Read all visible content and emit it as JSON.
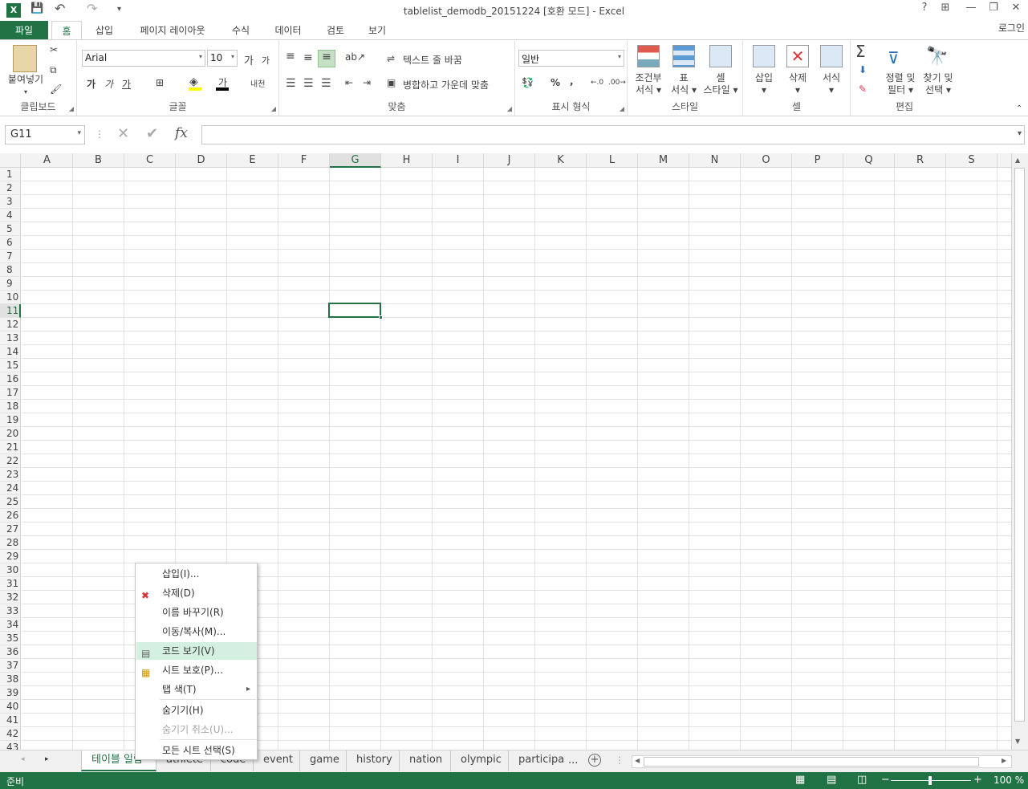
{
  "window": {
    "title": "tablelist_demodb_20151224  [호환 모드] - Excel",
    "help": "?",
    "restore_ribbon": "⊞",
    "minimize": "—",
    "maximize": "❐",
    "close": "✕"
  },
  "qat": {
    "excel_icon": "X",
    "save_icon": "💾",
    "undo_icon": "↶",
    "redo_icon": "↷",
    "customize_icon": "▾"
  },
  "tabs": [
    "파일",
    "홈",
    "삽입",
    "페이지 레이아웃",
    "수식",
    "데이터",
    "검토",
    "보기"
  ],
  "account": "로그인",
  "ribbon": {
    "clipboard": {
      "label": "클립보드",
      "paste": "붙여넣기"
    },
    "font": {
      "label": "글꼴",
      "font_name": "Arial",
      "font_size": "10",
      "grow": "가",
      "shrink": "가",
      "bold": "가",
      "italic": "가",
      "underline": "가",
      "fontcolor": "가",
      "phonetic": "내천"
    },
    "alignment": {
      "label": "맞춤",
      "wrap": "텍스트 줄 바꿈",
      "merge": "병합하고 가운데 맞춤"
    },
    "number": {
      "label": "표시 형식",
      "format": "일반",
      "percent": "%",
      "comma": ","
    },
    "styles": {
      "label": "스타일",
      "cond_line1": "조건부",
      "cond_line2": "서식",
      "table_line1": "표",
      "table_line2": "서식",
      "cell_line1": "셀",
      "cell_line2": "스타일"
    },
    "cells": {
      "label": "셀",
      "insert": "삽입",
      "delete": "삭제",
      "format": "서식"
    },
    "editing": {
      "label": "편집",
      "sort_line1": "정렬 및",
      "sort_line2": "필터",
      "find_line1": "찾기 및",
      "find_line2": "선택"
    }
  },
  "formula_bar": {
    "name_box": "G11",
    "cancel": "✕",
    "enter": "✔",
    "fx": "fx",
    "value": ""
  },
  "columns": [
    "A",
    "B",
    "C",
    "D",
    "E",
    "F",
    "G",
    "H",
    "I",
    "J",
    "K",
    "L",
    "M",
    "N",
    "O",
    "P",
    "Q",
    "R",
    "S"
  ],
  "rows": [
    "1",
    "2",
    "3",
    "4",
    "5",
    "6",
    "7",
    "8",
    "9",
    "10",
    "11",
    "12",
    "13",
    "14",
    "15",
    "16",
    "17",
    "18",
    "19",
    "20",
    "21",
    "22",
    "23",
    "24",
    "25",
    "26",
    "27",
    "28",
    "29",
    "30",
    "31",
    "32",
    "33",
    "34",
    "35",
    "36",
    "37",
    "38",
    "39",
    "40",
    "41",
    "42",
    "43"
  ],
  "sheets": [
    "테이블 일람",
    "athlete",
    "code",
    "event",
    "game",
    "history",
    "nation",
    "olympic",
    "participa"
  ],
  "sheet_more": "...",
  "status": {
    "ready": "준비",
    "zoom": "100 %",
    "minus": "−",
    "plus": "+"
  },
  "context_menu": [
    {
      "label": "삽입(I)...",
      "icon": ""
    },
    {
      "label": "삭제(D)",
      "icon": "✖"
    },
    {
      "label": "이름 바꾸기(R)",
      "icon": ""
    },
    {
      "label": "이동/복사(M)...",
      "icon": ""
    },
    {
      "label": "코드 보기(V)",
      "icon": "▤"
    },
    {
      "label": "시트 보호(P)...",
      "icon": "▦"
    },
    {
      "label": "탭 색(T)",
      "icon": "",
      "submenu": "▸"
    },
    {
      "label": "숨기기(H)",
      "icon": ""
    },
    {
      "label": "숨기기 취소(U)...",
      "icon": ""
    },
    {
      "label": "모든 시트 선택(S)",
      "icon": ""
    }
  ]
}
